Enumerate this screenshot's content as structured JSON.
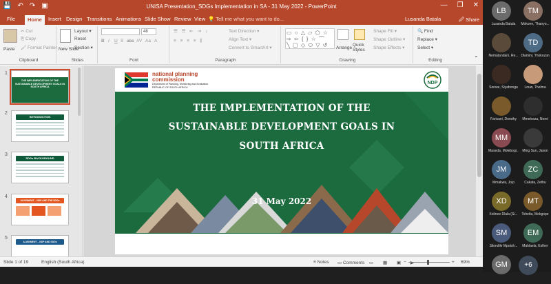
{
  "window": {
    "title": "UNISA Presentation_SDGs Implementation in SA - 31 May 2022 - PowerPoint",
    "qat": [
      "💾",
      "↶",
      "↷",
      "▣"
    ],
    "controls": [
      "—",
      "❐",
      "✕"
    ]
  },
  "tabs": [
    "File",
    "Home",
    "Insert",
    "Design",
    "Transitions",
    "Animations",
    "Slide Show",
    "Review",
    "View"
  ],
  "tell_me": "💡 Tell me what you want to do...",
  "user_name": "Lusanda Batala",
  "share_label": "🖉 Share",
  "ribbon": {
    "clipboard": {
      "label": "Clipboard",
      "paste": "Paste",
      "cut": "✂ Cut",
      "copy": "⎘ Copy",
      "format_painter": "🖌 Format Painter"
    },
    "slides": {
      "label": "Slides",
      "new_slide": "New Slide",
      "layout": "Layout ▾",
      "reset": "Reset",
      "section": "Section ▾"
    },
    "font": {
      "label": "Font",
      "size": "48",
      "buttons": [
        "B",
        "I",
        "U",
        "S",
        "abc",
        "AV",
        "Aa",
        "A"
      ]
    },
    "paragraph": {
      "label": "Paragraph",
      "text_direction": "Text Direction ▾",
      "align_text": "Align Text ▾",
      "convert_smartart": "Convert to SmartArt ▾"
    },
    "drawing": {
      "label": "Drawing",
      "arrange": "Arrange",
      "quick_styles": "Quick Styles",
      "shape_fill": "Shape Fill ▾",
      "shape_outline": "Shape Outline ▾",
      "shape_effects": "Shape Effects ▾"
    },
    "editing": {
      "label": "Editing",
      "find": "🔍 Find",
      "replace": "Replace ▾",
      "select": "Select ▾"
    }
  },
  "thumbnails": [
    {
      "num": "1",
      "title": "THE IMPLEMENTATION OF THE SUSTAINABLE DEVELOPMENT GOALS IN SOUTH AFRICA"
    },
    {
      "num": "2",
      "title": "INTRODUCTION"
    },
    {
      "num": "3",
      "title": "SDGs BACKGROUND"
    },
    {
      "num": "4",
      "title": "ALIGNMENT – NDP AND THE SDGs"
    },
    {
      "num": "5",
      "title": "ALIGNMENT – NDP AND SDGs"
    }
  ],
  "slide": {
    "org_name_1": "national planning",
    "org_name_2": "commission",
    "org_sub_1": "Department of Planning, Monitoring and Evaluation",
    "org_sub_2": "REPUBLIC OF SOUTH AFRICA",
    "ndp_label": "NDP",
    "title_line_1": "THE IMPLEMENTATION OF THE",
    "title_line_2": "SUSTAINABLE DEVELOPMENT GOALS IN",
    "title_line_3": "SOUTH AFRICA",
    "date": "31 May 2022"
  },
  "status": {
    "slide_of": "Slide 1 of 19",
    "language": "English (South Africa)",
    "notes": "≡ Notes",
    "comments": "▭ Comments",
    "zoom": "69%"
  },
  "participants": [
    {
      "initials": "LB",
      "name": "Lusanda Batala",
      "color": "#6b6b6b"
    },
    {
      "initials": "TM",
      "name": "Mokone, Thanyo...",
      "color": "#8a6f63"
    },
    {
      "initials": "",
      "name": "Nematandani, Re...",
      "color": "#5a4a3a"
    },
    {
      "initials": "TD",
      "name": "Dlamini, Thokozan",
      "color": "#4e6b86"
    },
    {
      "initials": "",
      "name": "Sonwe, Siyabonga",
      "color": "#3a2a22"
    },
    {
      "initials": "",
      "name": "Louw, Thelma",
      "color": "#c79a7a"
    },
    {
      "initials": "",
      "name": "Farisani, Dorothy",
      "color": "#7a5a2a"
    },
    {
      "initials": "",
      "name": "Mmelosza, Nomi",
      "color": "#2e2e2e"
    },
    {
      "initials": "MM",
      "name": "Maseda, Molebogi...",
      "color": "#8a4a52"
    },
    {
      "initials": "",
      "name": "Ming Sun, Jason",
      "color": "#3a3a3a"
    },
    {
      "initials": "JM",
      "name": "Mmakwa, Jojo",
      "color": "#4a6a8a"
    },
    {
      "initials": "ZC",
      "name": "Cakata, Zethu",
      "color": "#3f6a58"
    },
    {
      "initials": "XD",
      "name": "Xolinee Dlala (Si...",
      "color": "#7a6a2a"
    },
    {
      "initials": "MT",
      "name": "Tshetla, Mokgope",
      "color": "#7a5a2a"
    },
    {
      "initials": "SM",
      "name": "Silondile Mpotsh...",
      "color": "#4a5a7a"
    },
    {
      "initials": "EM",
      "name": "Mahlaela, Esther",
      "color": "#3f6a58"
    },
    {
      "initials": "GM",
      "name": "",
      "color": "#6b6b6b"
    }
  ],
  "more_participants": "+6"
}
